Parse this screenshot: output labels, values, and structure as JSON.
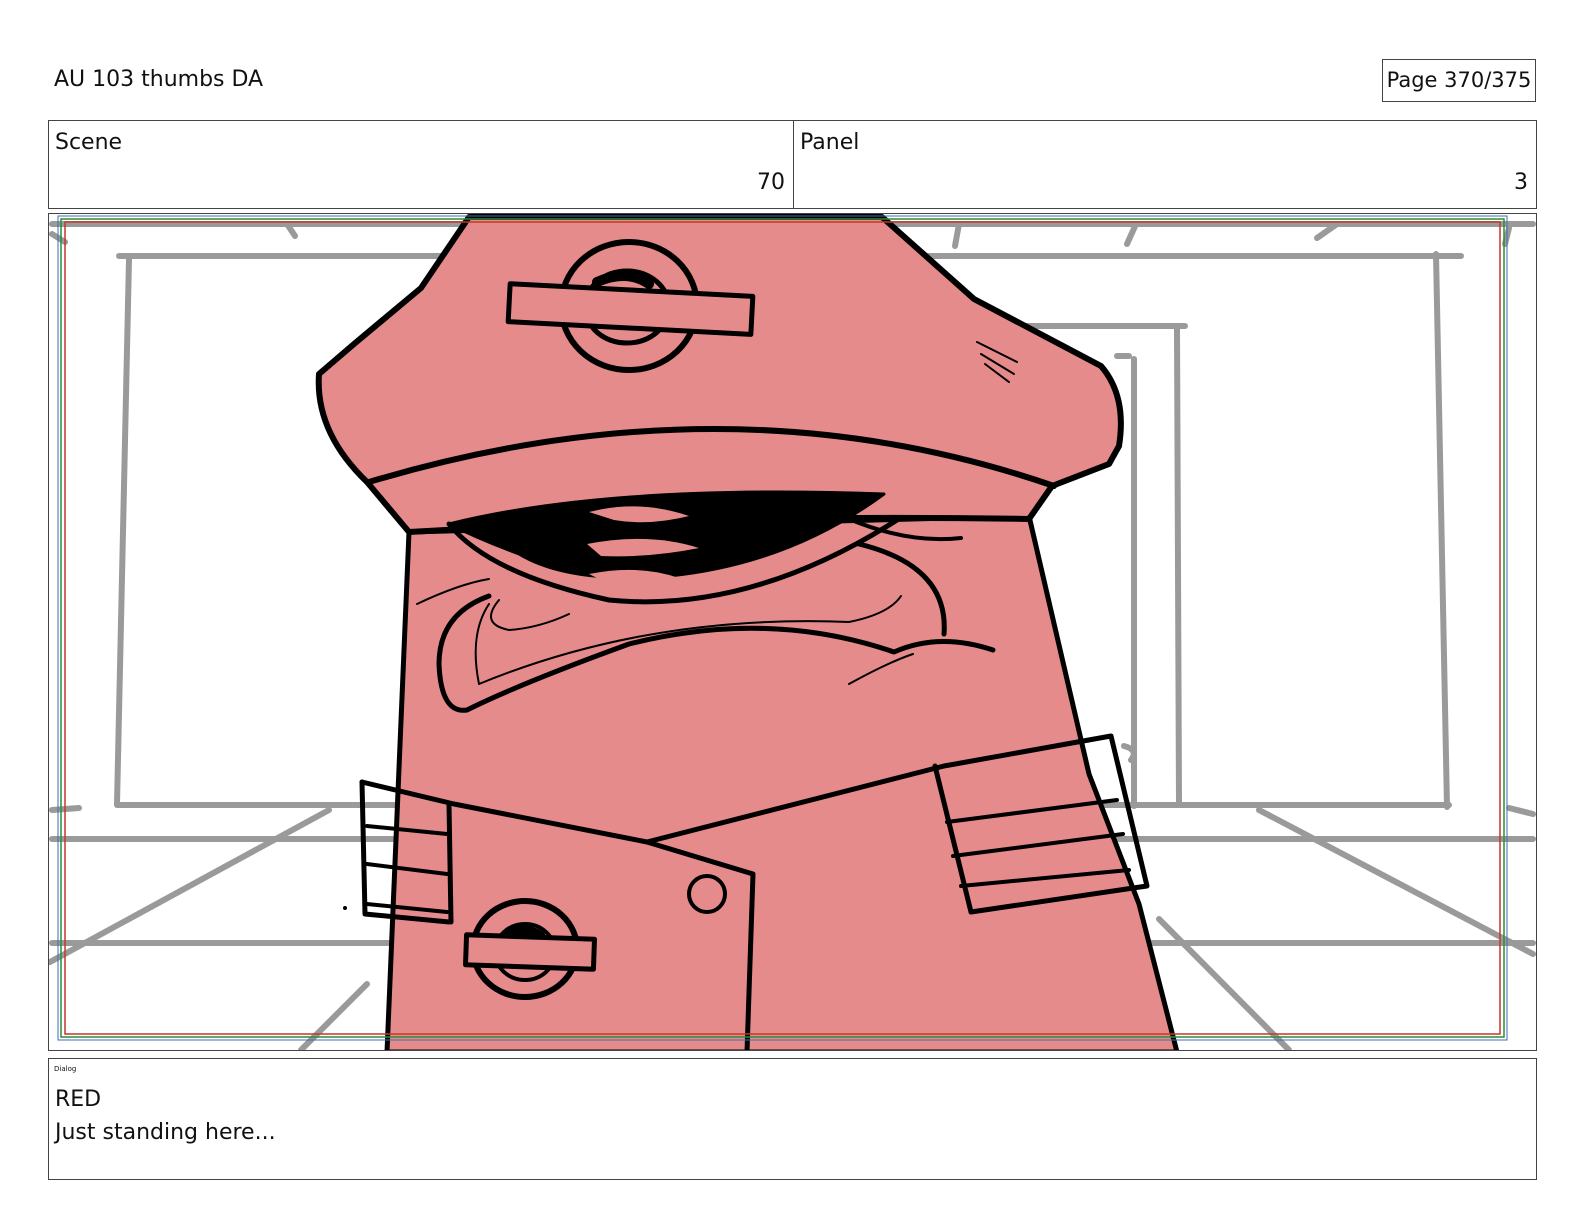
{
  "header": {
    "title": "AU 103 thumbs DA",
    "page_label": "Page 370/375"
  },
  "info": {
    "scene_label": "Scene",
    "scene_value": "70",
    "panel_label": "Panel",
    "panel_value": "3"
  },
  "frame": {
    "character_fill": "#e68b8b",
    "background_line_color": "#9a9a9a",
    "safe_frame_colors": [
      "#c0392b",
      "#2e8b3a",
      "#3a6fb0"
    ]
  },
  "dialog": {
    "label": "Dialog",
    "speaker": "RED",
    "line": "Just standing here..."
  }
}
